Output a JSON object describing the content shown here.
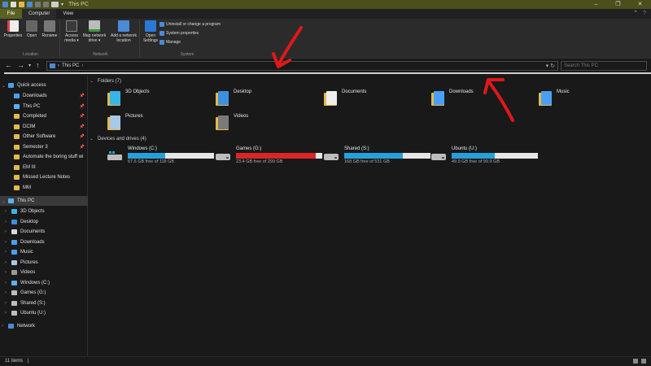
{
  "window": {
    "title": "This PC",
    "controls": [
      "–",
      "❐",
      "✕"
    ]
  },
  "tabs": {
    "file": "File",
    "computer": "Computer",
    "view": "View"
  },
  "ribbon": {
    "location": {
      "label": "Location",
      "properties": "Properties",
      "open": "Open",
      "rename": "Rename"
    },
    "network": {
      "label": "Network",
      "access_media": "Access media ▾",
      "map_network_drive": "Map network drive ▾",
      "add_network_location": "Add a network location"
    },
    "system": {
      "label": "System",
      "open_settings": "Open Settings",
      "uninstall": "Uninstall or change a program",
      "system_properties": "System properties",
      "manage": "Manage"
    }
  },
  "address": {
    "breadcrumb": "This PC",
    "separator": "›",
    "search_placeholder": "Search This PC"
  },
  "nav": {
    "quick_access": "Quick access",
    "quick_items": [
      {
        "label": "Downloads",
        "color": "#4a9ff5",
        "pinned": true
      },
      {
        "label": "This PC",
        "color": "#5ab0f0",
        "pinned": true
      },
      {
        "label": "Completed",
        "color": "#e3b94b",
        "pinned": true
      },
      {
        "label": "DCIM",
        "color": "#e3b94b",
        "pinned": true
      },
      {
        "label": "Other Software",
        "color": "#e3b94b",
        "pinned": true
      },
      {
        "label": "Semester 3",
        "color": "#e3b94b",
        "pinned": true
      },
      {
        "label": "Automate the boring stuff wi",
        "color": "#e3b94b",
        "pinned": false
      },
      {
        "label": "EM III",
        "color": "#e3b94b",
        "pinned": false
      },
      {
        "label": "Missed Lecture Notes",
        "color": "#e3b94b",
        "pinned": false
      },
      {
        "label": "MM",
        "color": "#e3b94b",
        "pinned": false
      }
    ],
    "this_pc": "This PC",
    "pc_items": [
      {
        "label": "3D Objects",
        "color": "#37b4e8"
      },
      {
        "label": "Desktop",
        "color": "#3d8fe0"
      },
      {
        "label": "Documents",
        "color": "#d9d9d9"
      },
      {
        "label": "Downloads",
        "color": "#4a9ff5"
      },
      {
        "label": "Music",
        "color": "#4a9ff5"
      },
      {
        "label": "Pictures",
        "color": "#a8c8e8"
      },
      {
        "label": "Videos",
        "color": "#9a9a9a"
      },
      {
        "label": "Windows (C:)",
        "color": "#5ab0f0"
      },
      {
        "label": "Games (G:)",
        "color": "#bdbdbd"
      },
      {
        "label": "Shared (S:)",
        "color": "#bdbdbd"
      },
      {
        "label": "Ubuntu (U:)",
        "color": "#bdbdbd"
      }
    ],
    "network": "Network"
  },
  "content": {
    "folders_header": "Folders (7)",
    "folders": [
      {
        "label": "3D Objects",
        "color": "#37b4e8"
      },
      {
        "label": "Desktop",
        "color": "#3d8fe0"
      },
      {
        "label": "Documents",
        "color": "#eeeeee"
      },
      {
        "label": "Downloads",
        "color": "#4a9ff5"
      },
      {
        "label": "Music",
        "color": "#4a9ff5"
      },
      {
        "label": "Pictures",
        "color": "#a8c8e8"
      },
      {
        "label": "Videos",
        "color": "#7a7a7a"
      }
    ],
    "drives_header": "Devices and drives (4)",
    "drives": [
      {
        "name": "Windows (C:)",
        "free": "67.6 GB free of 118 GB",
        "used_fraction": 0.43,
        "color": "#26a0da"
      },
      {
        "name": "Games (G:)",
        "free": "23.4 GB free of 299 GB",
        "used_fraction": 0.92,
        "color": "#da2626"
      },
      {
        "name": "Shared (S:)",
        "free": "168 GB free of 531 GB",
        "used_fraction": 0.68,
        "color": "#26a0da"
      },
      {
        "name": "Ubuntu (U:)",
        "free": "49.9 GB free of 99.9 GB",
        "used_fraction": 0.5,
        "color": "#26a0da"
      }
    ]
  },
  "status": {
    "items": "11 items",
    "sep": "|"
  },
  "annotation_color": "#e01818"
}
